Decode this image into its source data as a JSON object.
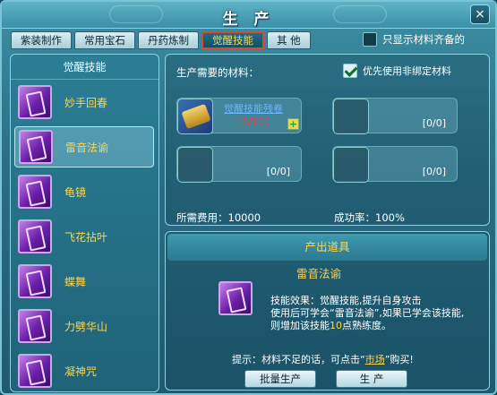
{
  "window": {
    "title": "生 产",
    "close_glyph": "×"
  },
  "tabs": [
    {
      "label": "紫装制作"
    },
    {
      "label": "常用宝石"
    },
    {
      "label": "丹药炼制"
    },
    {
      "label": "觉醒技能",
      "active": true
    },
    {
      "label": "其 他"
    }
  ],
  "only_complete": {
    "label": "只显示材料齐备的",
    "checked": false
  },
  "left": {
    "header": "觉醒技能",
    "items": [
      {
        "label": "妙手回春",
        "icon": "book-icon"
      },
      {
        "label": "雷音法谕",
        "icon": "book-icon",
        "selected": true
      },
      {
        "label": "龟镜",
        "icon": "book-icon"
      },
      {
        "label": "飞花拈叶",
        "icon": "book-icon"
      },
      {
        "label": "蝶舞",
        "icon": "book-icon"
      },
      {
        "label": "力劈华山",
        "icon": "book-icon"
      },
      {
        "label": "凝神咒",
        "icon": "book-icon"
      }
    ]
  },
  "materials": {
    "title": "生产需要的材料：",
    "prefer_label": "优先使用非绑定材料",
    "prefer_checked": true,
    "slots": [
      {
        "name": "觉醒技能残卷",
        "count": "[0/10]",
        "icon": "scroll-icon"
      },
      {
        "name": "",
        "count": "[0/0]"
      },
      {
        "name": "",
        "count": "[0/0]"
      },
      {
        "name": "",
        "count": "[0/0]"
      }
    ],
    "plus_label": "+",
    "fee": "所需费用：10000",
    "rate": "成功率：100%"
  },
  "output": {
    "header": "产出道具",
    "name": "雷音法谕",
    "desc_1": "技能效果：觉醒技能,提升自身攻击",
    "desc_2": "使用后可学会“雷音法谕”,如果已学会该技能,",
    "desc_3_pre": "则增加该技能",
    "desc_3_num": "10",
    "desc_3_post": "点熟练度。",
    "tip_pre": "提示：材料不足的话，可点击“",
    "tip_link": "市场",
    "tip_post": "”购买!",
    "batch_label": "批量生产",
    "produce_label": "生 产"
  },
  "colors": {
    "accent": "#ffd54a",
    "active_tab_border": "#e0452e",
    "shortage": "#ff3b3b",
    "link": "#6fb4ff"
  }
}
